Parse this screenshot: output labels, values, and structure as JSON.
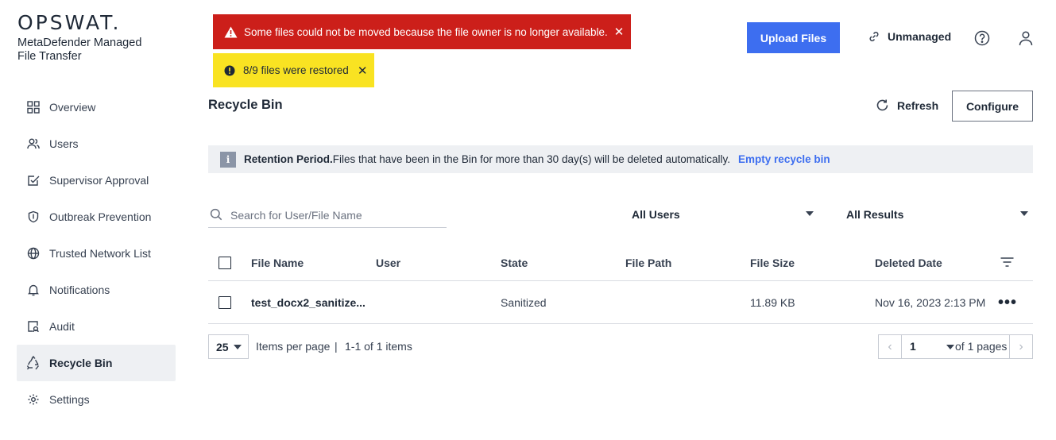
{
  "brand": {
    "logo": "OPSWAT.",
    "product_line1": "MetaDefender Managed",
    "product_line2": "File Transfer"
  },
  "sidebar": {
    "items": [
      {
        "label": "Overview",
        "icon": "grid-icon"
      },
      {
        "label": "Users",
        "icon": "users-icon"
      },
      {
        "label": "Supervisor Approval",
        "icon": "approval-icon"
      },
      {
        "label": "Outbreak Prevention",
        "icon": "shield-icon"
      },
      {
        "label": "Trusted Network List",
        "icon": "globe-icon"
      },
      {
        "label": "Notifications",
        "icon": "bell-icon"
      },
      {
        "label": "Audit",
        "icon": "audit-icon"
      },
      {
        "label": "Recycle Bin",
        "icon": "recycle-icon",
        "active": true
      },
      {
        "label": "Settings",
        "icon": "gear-icon"
      }
    ]
  },
  "alerts": {
    "error": "Some files could not be moved because the file owner is no longer available.",
    "success": "8/9 files were restored",
    "close_glyph": "✕"
  },
  "header": {
    "upload_label": "Upload Files",
    "unmanaged_label": "Unmanaged"
  },
  "page": {
    "title": "Recycle Bin",
    "refresh_label": "Refresh",
    "configure_label": "Configure"
  },
  "info": {
    "badge": "i",
    "bold": "Retention Period.",
    "text": "Files that have been in the Bin for more than 30 day(s) will be deleted automatically.",
    "link": "Empty recycle bin"
  },
  "filters": {
    "search_placeholder": "Search for User/File Name",
    "users_value": "All Users",
    "results_value": "All Results"
  },
  "table": {
    "columns": [
      "File Name",
      "User",
      "State",
      "File Path",
      "File Size",
      "Deleted Date"
    ],
    "rows": [
      {
        "file_name": "test_docx2_sanitize...",
        "user": "",
        "state": "Sanitized",
        "file_path": "",
        "file_size": "11.89 KB",
        "deleted_date": "Nov 16, 2023 2:13 PM",
        "more": "•••"
      }
    ]
  },
  "pagination": {
    "per_page": "25",
    "per_page_label": "Items per page",
    "separator": "|",
    "range": "1-1 of 1 items",
    "page": "1",
    "of_pages": "of 1 pages",
    "prev_glyph": "‹",
    "next_glyph": "›"
  },
  "colors": {
    "accent": "#3d6ef0",
    "error": "#cc1f1a",
    "warning": "#f9e322"
  }
}
